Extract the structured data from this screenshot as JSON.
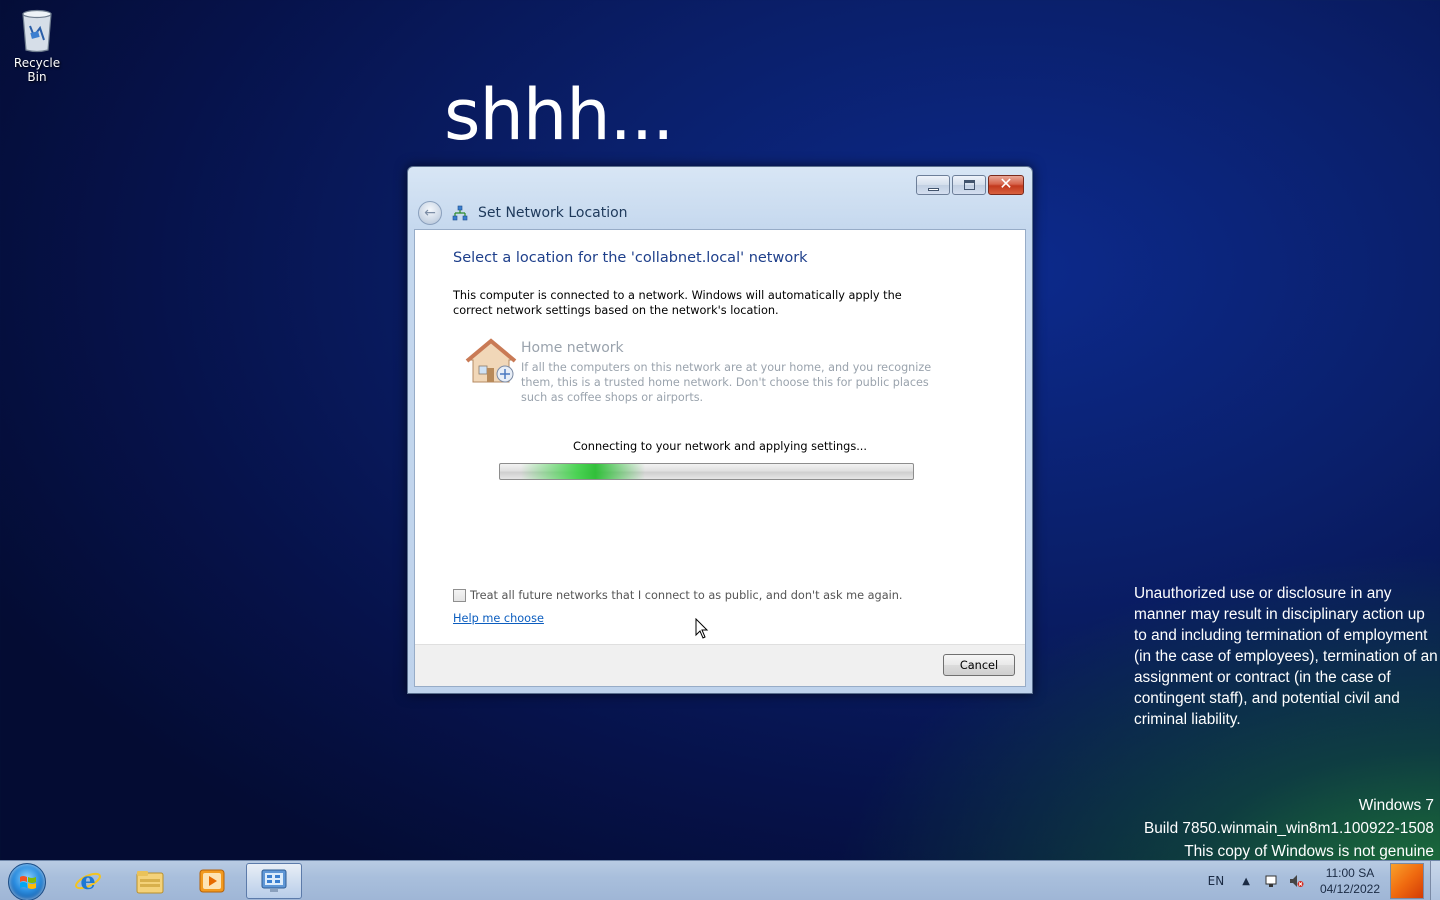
{
  "desktop": {
    "recycle_bin_label": "Recycle Bin",
    "wallpaper_title": "shhh...",
    "disclaimer": "Unauthorized use or disclosure in any manner may result in disciplinary action up to and including termination of employment (in the case of employees), termination of an assignment or contract (in the case of contingent staff), and potential civil and criminal liability.",
    "watermark": {
      "line1": "Windows 7",
      "line2": "Build 7850.winmain_win8m1.100922-1508",
      "line3": "This copy of Windows is not genuine"
    }
  },
  "dialog": {
    "title": "Set Network Location",
    "heading": "Select a location for the 'collabnet.local' network",
    "intro": "This computer is connected to a network. Windows will automatically apply the correct network settings based on the network's location.",
    "option": {
      "title": "Home network",
      "description": "If all the computers on this network are at your home, and you recognize them, this is a trusted home network.  Don't choose this for public places such as coffee shops or airports.",
      "icon": "house-network-icon"
    },
    "progress_text": "Connecting to your network and applying settings...",
    "checkbox_label": "Treat all future networks that I connect to as public, and don't ask me again.",
    "checkbox_checked": false,
    "help_link": "Help me choose",
    "cancel_label": "Cancel"
  },
  "taskbar": {
    "items": [
      "start-orb",
      "internet-explorer-icon",
      "windows-explorer-icon",
      "media-player-icon",
      "network-control-panel-icon"
    ],
    "active_item": "network-control-panel-icon",
    "tray": {
      "language": "EN",
      "time": "11:00 SA",
      "date": "04/12/2022"
    }
  },
  "colors": {
    "heading_blue": "#1e3f8b",
    "link_blue": "#0b5dbf",
    "disabled_gray": "#9aa3ad",
    "progress_green": "#3cd246"
  }
}
